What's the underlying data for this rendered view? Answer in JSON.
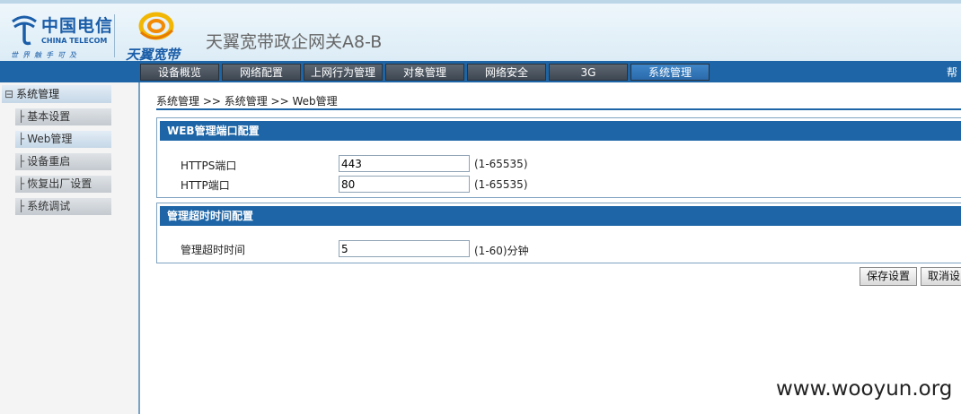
{
  "header": {
    "brand_cn": "中国电信",
    "brand_en": "CHINA TELECOM",
    "brand_slogan": "世界触手可及",
    "sub_brand": "天翼宽带",
    "app_title": "天翼宽带政企网关A8-B"
  },
  "nav": {
    "tabs": [
      "设备概览",
      "网络配置",
      "上网行为管理",
      "对象管理",
      "网络安全",
      "3G",
      "系统管理"
    ],
    "active": "系统管理",
    "help": "帮"
  },
  "sidebar": {
    "root": "系统管理",
    "items": [
      "基本设置",
      "Web管理",
      "设备重启",
      "恢复出厂设置",
      "系统调试"
    ],
    "active": "Web管理"
  },
  "breadcrumb": "系统管理 >> 系统管理 >> Web管理",
  "web_port_section": {
    "title": "WEB管理端口配置",
    "https_label": "HTTPS端口",
    "https_value": "443",
    "https_hint": "(1-65535)",
    "http_label": "HTTP端口",
    "http_value": "80",
    "http_hint": "(1-65535)"
  },
  "timeout_section": {
    "title": "管理超时时间配置",
    "label": "管理超时时间",
    "value": "5",
    "hint": "(1-60)分钟"
  },
  "buttons": {
    "save": "保存设置",
    "cancel": "取消设"
  },
  "watermark": "www.wooyun.org",
  "colors": {
    "nav_bar": "#1d65a6",
    "section_header": "#1d65a6",
    "tab_inactive": "#4a535e",
    "tab_active": "#3578bb"
  }
}
